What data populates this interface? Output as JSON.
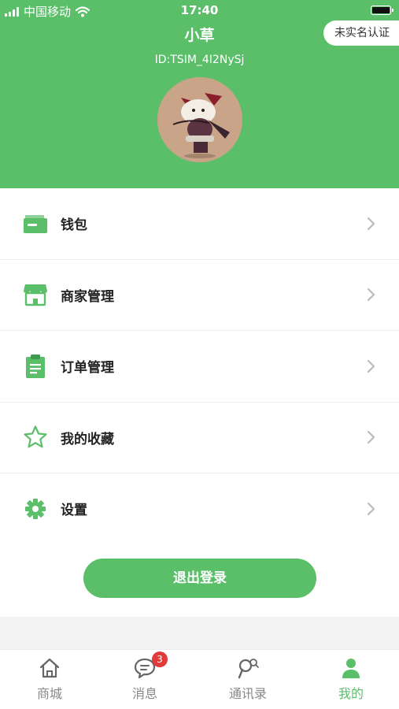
{
  "status_bar": {
    "carrier": "中国移动",
    "time": "17:40"
  },
  "profile": {
    "name": "小草",
    "verify_label": "未实名认证",
    "id_text": "ID:TSIM_4I2NySj"
  },
  "menu": {
    "items": [
      {
        "label": "钱包",
        "icon": "wallet-icon"
      },
      {
        "label": "商家管理",
        "icon": "store-icon"
      },
      {
        "label": "订单管理",
        "icon": "clipboard-icon"
      },
      {
        "label": "我的收藏",
        "icon": "star-icon"
      },
      {
        "label": "设置",
        "icon": "gear-icon"
      }
    ]
  },
  "logout_label": "退出登录",
  "tabbar": {
    "tabs": [
      {
        "label": "商城",
        "icon": "home-icon"
      },
      {
        "label": "消息",
        "icon": "chat-icon",
        "badge": "3"
      },
      {
        "label": "通讯录",
        "icon": "contacts-icon"
      },
      {
        "label": "我的",
        "icon": "person-icon"
      }
    ],
    "active_index": 3
  },
  "colors": {
    "accent": "#5bbf6a",
    "badge": "#e03a3a"
  }
}
